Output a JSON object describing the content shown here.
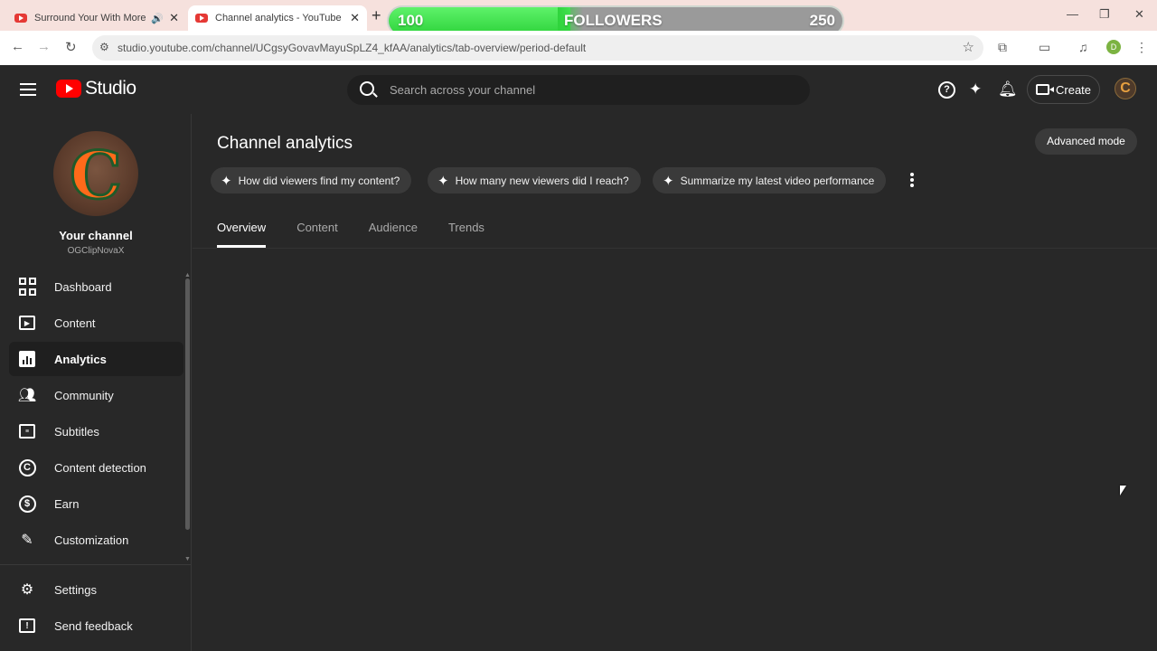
{
  "browser": {
    "tabs": [
      {
        "title": "Surround Your With More V",
        "active": false
      },
      {
        "title": "Channel analytics - YouTube St",
        "active": true
      }
    ],
    "new_tab_glyph": "+",
    "url": "studio.youtube.com/channel/UCgsyGovavMayuSpLZ4_kfAA/analytics/tab-overview/period-default",
    "profile_initial": "D"
  },
  "followers_widget": {
    "current": "100",
    "label": "FOLLOWERS",
    "goal": "250",
    "progress_fraction": 0.4
  },
  "header": {
    "logo_text": "Studio",
    "search_placeholder": "Search across your channel",
    "create_label": "Create",
    "help_glyph": "?"
  },
  "sidebar": {
    "channel_name": "Your channel",
    "channel_handle": "OGClipNovaX",
    "avatar_letter": "C",
    "items": [
      {
        "label": "Dashboard",
        "icon": "dashboard-icon",
        "active": false
      },
      {
        "label": "Content",
        "icon": "content-icon",
        "active": false
      },
      {
        "label": "Analytics",
        "icon": "analytics-icon",
        "active": true
      },
      {
        "label": "Community",
        "icon": "community-icon",
        "active": false
      },
      {
        "label": "Subtitles",
        "icon": "subtitles-icon",
        "active": false
      },
      {
        "label": "Content detection",
        "icon": "copyright-icon",
        "active": false
      },
      {
        "label": "Earn",
        "icon": "dollar-icon",
        "active": false
      },
      {
        "label": "Customization",
        "icon": "magic-wand-icon",
        "active": false
      }
    ],
    "bottom_items": [
      {
        "label": "Settings",
        "icon": "gear-icon"
      },
      {
        "label": "Send feedback",
        "icon": "feedback-icon"
      }
    ]
  },
  "main": {
    "title": "Channel analytics",
    "advanced_mode_label": "Advanced mode",
    "suggestions": [
      "How did viewers find my content?",
      "How many new viewers did I reach?",
      "Summarize my latest video performance"
    ],
    "tabs": [
      {
        "label": "Overview",
        "active": true
      },
      {
        "label": "Content",
        "active": false
      },
      {
        "label": "Audience",
        "active": false
      },
      {
        "label": "Trends",
        "active": false
      }
    ]
  },
  "colors": {
    "background": "#282828",
    "accent_red": "#ff0000",
    "progress_green": "#2fd43c"
  }
}
